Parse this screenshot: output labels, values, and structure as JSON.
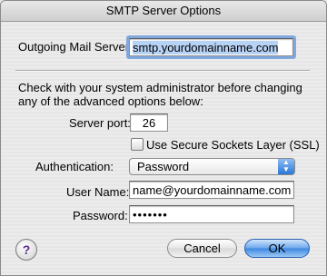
{
  "window": {
    "title": "SMTP Server Options"
  },
  "outgoing": {
    "label": "Outgoing Mail Server:",
    "value": "smtp.yourdomainname.com"
  },
  "advanced": {
    "note": "Check with your system administrator before changing any of the advanced options below:",
    "server_port_label": "Server port:",
    "server_port_value": "26",
    "ssl_label": "Use Secure Sockets Layer (SSL)",
    "ssl_checked": false,
    "auth_label": "Authentication:",
    "auth_value": "Password",
    "username_label": "User Name:",
    "username_value": "name@yourdomainname.com",
    "password_label": "Password:",
    "password_mask": "•••••••"
  },
  "buttons": {
    "help": "?",
    "cancel": "Cancel",
    "ok": "OK"
  },
  "colors": {
    "focus_ring": "#7fa8de",
    "selection": "#b6d2f5",
    "default_button": "#3d87e0"
  }
}
